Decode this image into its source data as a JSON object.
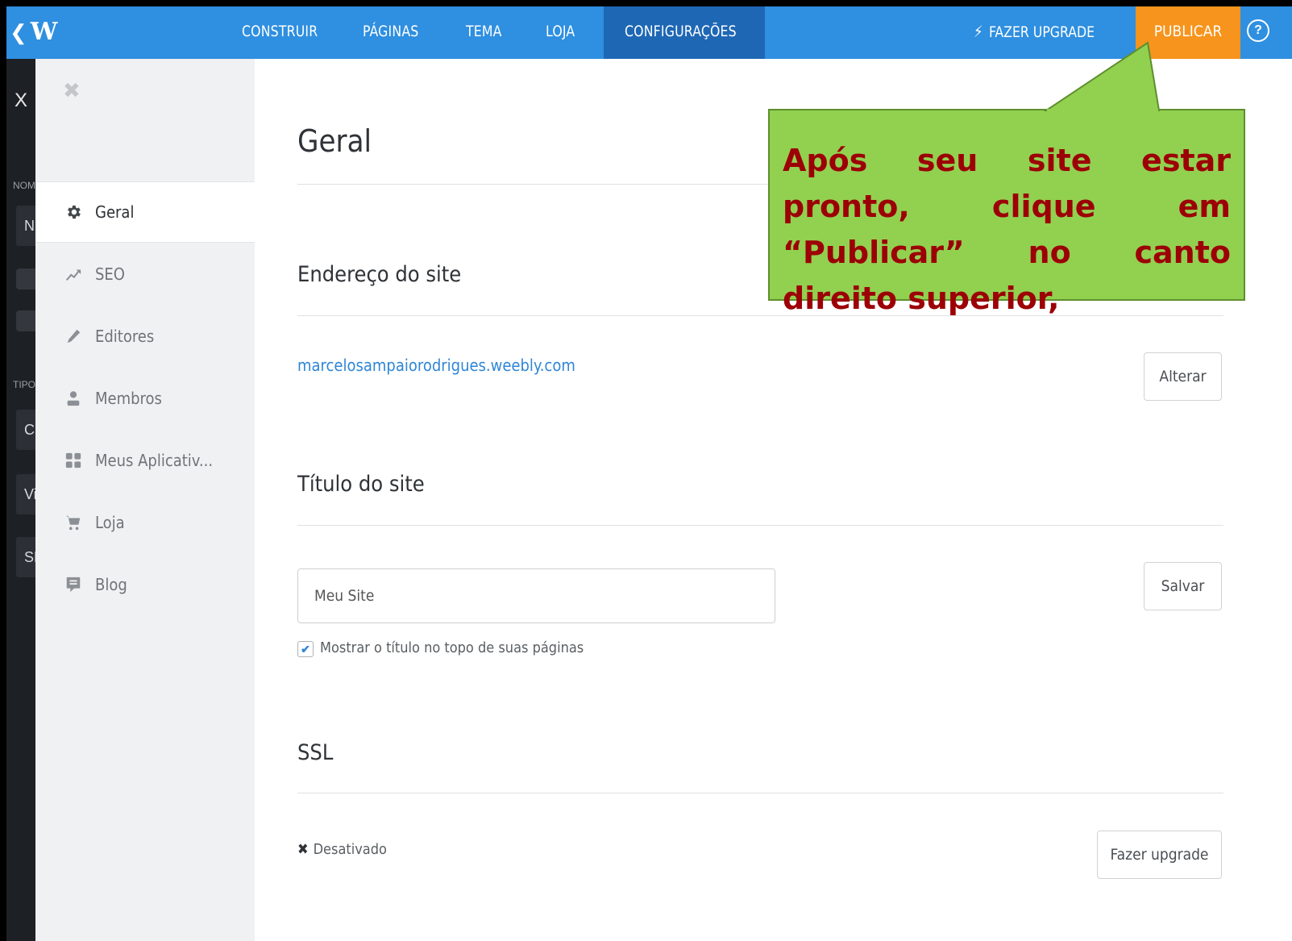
{
  "topbar": {
    "back_icon": "chevron-left-icon",
    "logo_letter": "W",
    "tabs": [
      {
        "label": "CONSTRUIR"
      },
      {
        "label": "PÁGINAS"
      },
      {
        "label": "TEMA"
      },
      {
        "label": "LOJA"
      },
      {
        "label": "CONFIGURAÇÕES",
        "active": true
      }
    ],
    "upgrade_label": "FAZER UPGRADE",
    "publish_label": "PUBLICAR",
    "help_label": "?"
  },
  "left_panel": {
    "close_label": "X",
    "label_1": "NOM",
    "field_1": "N",
    "label_2": "TIPO",
    "field_2": "C",
    "field_3": "Vi",
    "field_4": "SE"
  },
  "sidebar": {
    "close_label": "✖",
    "items": [
      {
        "label": "Geral",
        "icon": "gear-icon",
        "active": true
      },
      {
        "label": "SEO",
        "icon": "trend-icon"
      },
      {
        "label": "Editores",
        "icon": "pencil-icon"
      },
      {
        "label": "Membros",
        "icon": "user-icon"
      },
      {
        "label": "Meus Aplicativ...",
        "icon": "apps-icon"
      },
      {
        "label": "Loja",
        "icon": "cart-icon"
      },
      {
        "label": "Blog",
        "icon": "comment-icon"
      }
    ]
  },
  "main": {
    "title": "Geral",
    "address": {
      "heading": "Endereço do site",
      "url": "marcelosampaiorodrigues.weebly.com",
      "button": "Alterar"
    },
    "site_title": {
      "heading": "Título do site",
      "value": "Meu Site",
      "button": "Salvar",
      "checkbox_label": "Mostrar o título no topo de suas páginas",
      "checkbox_checked": true
    },
    "ssl": {
      "heading": "SSL",
      "status": "Desativado",
      "button": "Fazer upgrade"
    }
  },
  "callout": {
    "text": "Após seu site estar pronto, clique em “Publicar” no canto direito superior,"
  },
  "colors": {
    "topbar": "#2f8fe0",
    "active_tab": "#1e67b5",
    "publish": "#f7941d",
    "callout_bg": "#92d050",
    "callout_text": "#9c0006",
    "link": "#2f86d6"
  }
}
